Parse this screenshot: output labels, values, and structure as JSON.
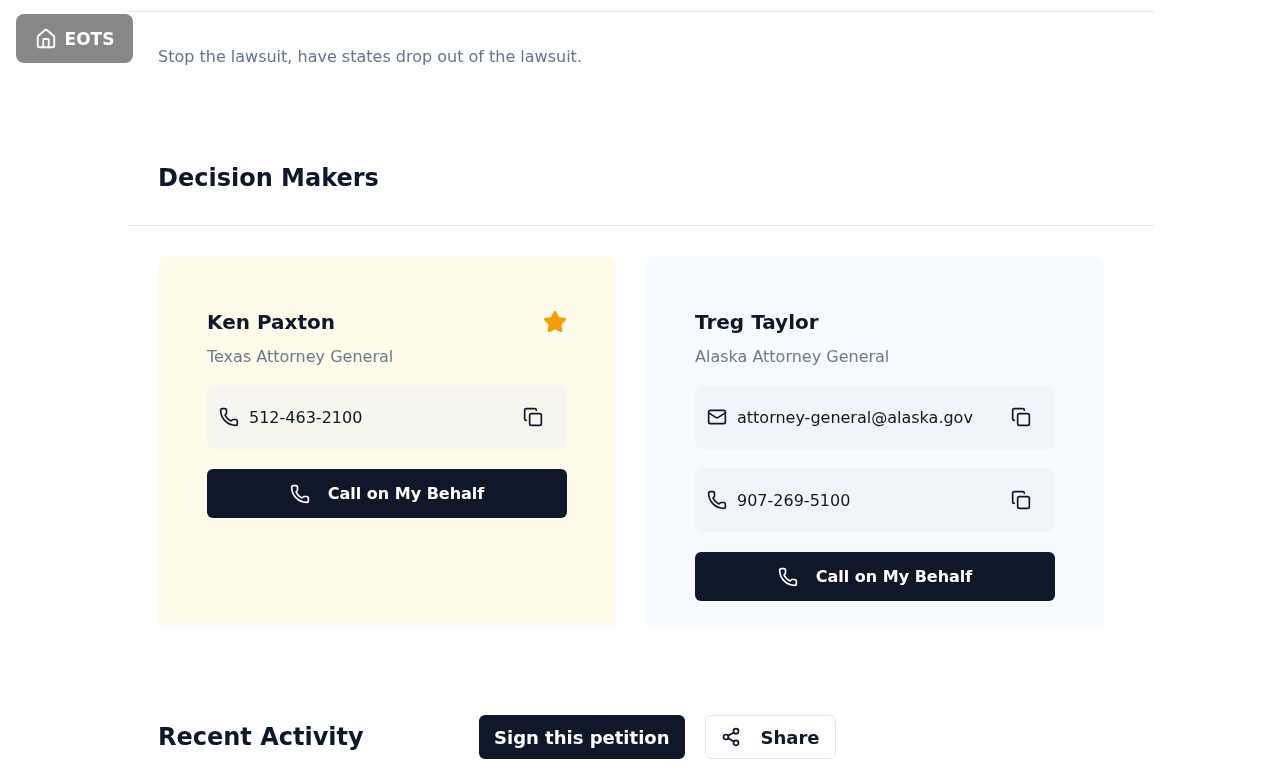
{
  "home_button": {
    "label": "EOTS"
  },
  "description": "Stop the lawsuit, have states drop out of the lawsuit.",
  "decision_makers": {
    "heading": "Decision Makers",
    "people": [
      {
        "name": "Ken Paxton",
        "role": "Texas Attorney General",
        "starred": true,
        "contacts": [
          {
            "kind": "phone",
            "value": "512-463-2100"
          }
        ],
        "action": "Call on My Behalf"
      },
      {
        "name": "Treg Taylor",
        "role": "Alaska Attorney General",
        "starred": false,
        "contacts": [
          {
            "kind": "email",
            "value": "attorney-general@alaska.gov"
          },
          {
            "kind": "phone",
            "value": "907-269-5100"
          }
        ],
        "action": "Call on My Behalf"
      }
    ]
  },
  "recent_activity": {
    "heading": "Recent Activity"
  },
  "actions": {
    "sign": "Sign this petition",
    "share": "Share"
  }
}
